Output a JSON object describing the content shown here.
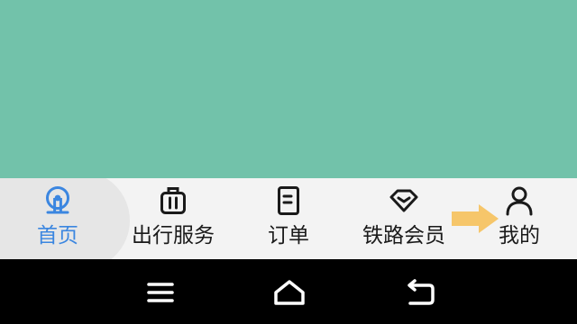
{
  "colors": {
    "content_background": "#72c2aa",
    "tabbar_background": "#f3f3f3",
    "active_tab": "#3b86e0",
    "inactive_tab": "#1a1a1a",
    "arrow_hint": "#f6c66a",
    "navbar_background": "#000000",
    "navbar_icon": "#ffffff"
  },
  "tabbar": {
    "active": "home",
    "tabs": [
      {
        "id": "home",
        "label": "首页",
        "icon": "railway-logo-icon"
      },
      {
        "id": "travel",
        "label": "出行服务",
        "icon": "luggage-icon"
      },
      {
        "id": "orders",
        "label": "订单",
        "icon": "order-document-icon"
      },
      {
        "id": "member",
        "label": "铁路会员",
        "icon": "diamond-icon"
      },
      {
        "id": "mine",
        "label": "我的",
        "icon": "person-icon"
      }
    ]
  },
  "system_navbar": {
    "buttons": [
      {
        "id": "menu",
        "icon": "menu-icon"
      },
      {
        "id": "home",
        "icon": "home-icon"
      },
      {
        "id": "back",
        "icon": "back-icon"
      }
    ]
  }
}
